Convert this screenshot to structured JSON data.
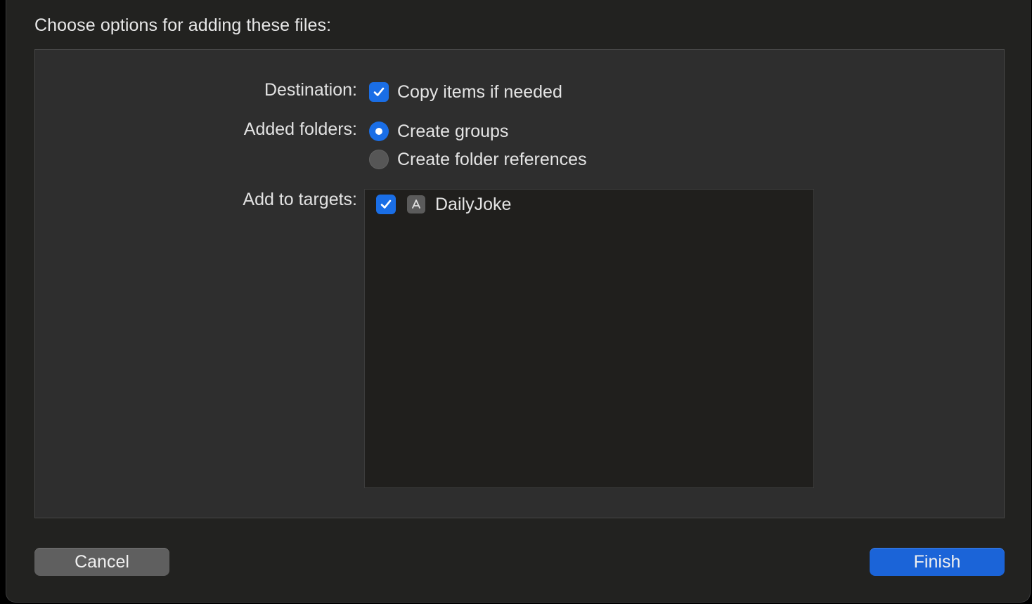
{
  "dialog": {
    "title": "Choose options for adding these files:"
  },
  "destination": {
    "label": "Destination:",
    "option": {
      "label": "Copy items if needed",
      "checked": true
    }
  },
  "added_folders": {
    "label": "Added folders:",
    "options": [
      {
        "label": "Create groups",
        "selected": true
      },
      {
        "label": "Create folder references",
        "selected": false
      }
    ]
  },
  "targets": {
    "label": "Add to targets:",
    "items": [
      {
        "name": "DailyJoke",
        "checked": true,
        "icon": "app-target-icon"
      }
    ]
  },
  "buttons": {
    "cancel": "Cancel",
    "finish": "Finish"
  },
  "colors": {
    "accent": "#1a6ee6",
    "background": "#222220",
    "panel": "#2e2e2e"
  }
}
